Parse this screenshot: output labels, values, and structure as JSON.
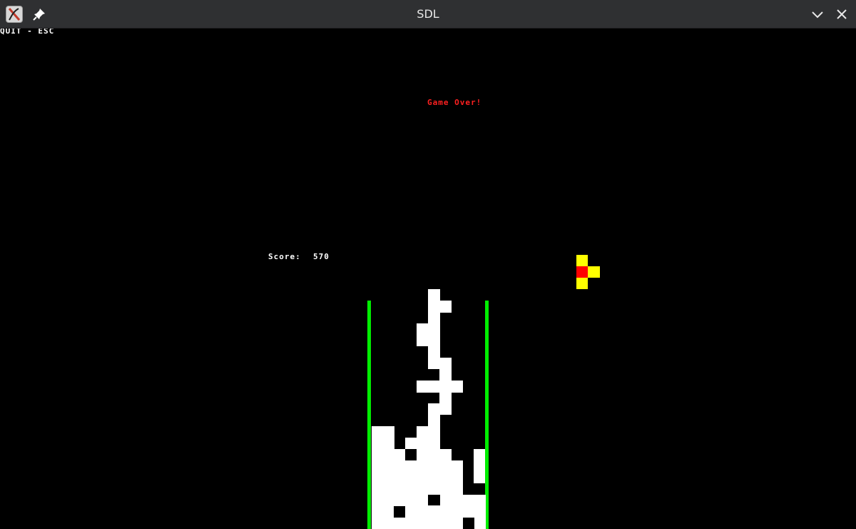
{
  "window": {
    "title": "SDL",
    "icons": {
      "app": "x-app-icon",
      "pin": "pin-icon",
      "minimize": "chevron-down-icon",
      "close": "close-icon"
    }
  },
  "game": {
    "quit_hint": "QUIT - ESC",
    "status": "Game Over!",
    "score_label": "Score:",
    "score_value": "570",
    "colors": {
      "wall": "#00ee00",
      "stack": "#ffffff",
      "status": "#ff2020",
      "next_piece": "#ffff00",
      "next_piece_center": "#ff0000",
      "background": "#000000"
    }
  }
}
